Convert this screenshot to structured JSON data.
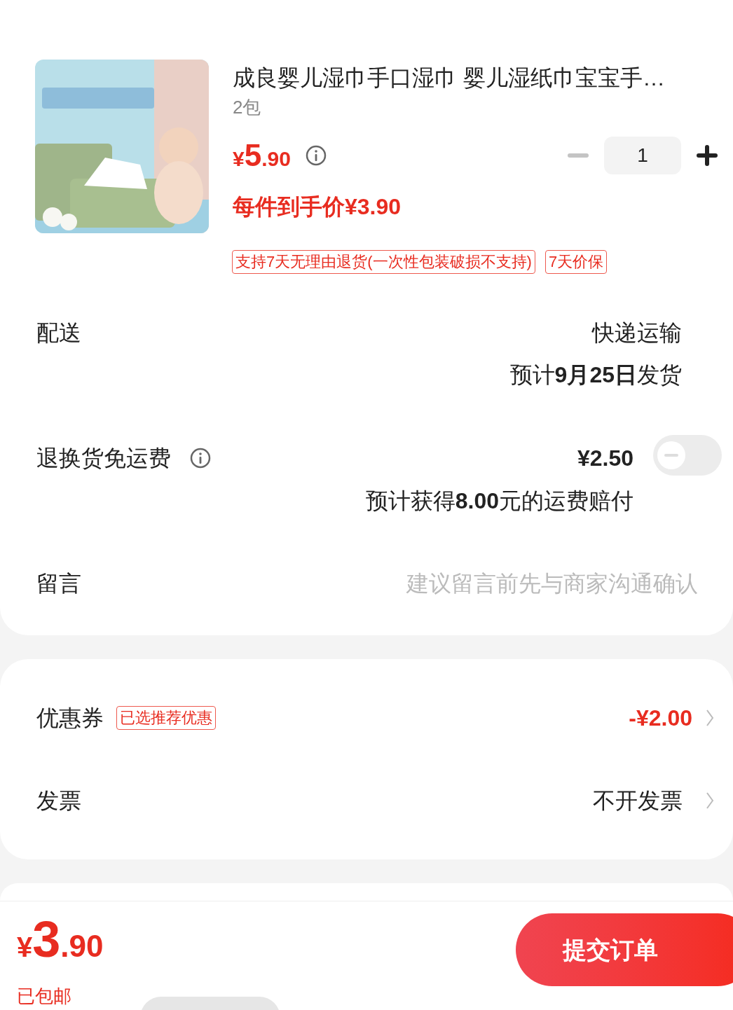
{
  "product": {
    "title": "成良婴儿湿巾手口湿巾 婴儿湿纸巾宝宝手…",
    "spec": "2包",
    "price_symbol": "¥",
    "price_int": "5",
    "price_dec": ".90",
    "net_price": "每件到手价¥3.90",
    "quantity": "1",
    "decrease_disabled": true,
    "tags": [
      "支持7天无理由退货(一次性包装破损不支持)",
      "7天价保"
    ]
  },
  "delivery": {
    "label": "配送",
    "method": "快递运输",
    "eta_prefix": "预计",
    "eta_date": "9月25日",
    "eta_suffix": "发货"
  },
  "return_shipping": {
    "label": "退换货免运费",
    "price": "¥2.50",
    "note_prefix": "预计获得",
    "note_amount": "8.00",
    "note_suffix": "元的运费赔付",
    "on": false
  },
  "message": {
    "label": "留言",
    "placeholder": "建议留言前先与商家沟通确认"
  },
  "coupon": {
    "label": "优惠券",
    "badge": "已选推荐优惠",
    "value": "-¥2.00"
  },
  "invoice": {
    "label": "发票",
    "value": "不开发票"
  },
  "footer": {
    "price_symbol": "¥",
    "price_int": "3",
    "price_dec": ".90",
    "shipping": "已包邮",
    "submit": "提交订单"
  }
}
